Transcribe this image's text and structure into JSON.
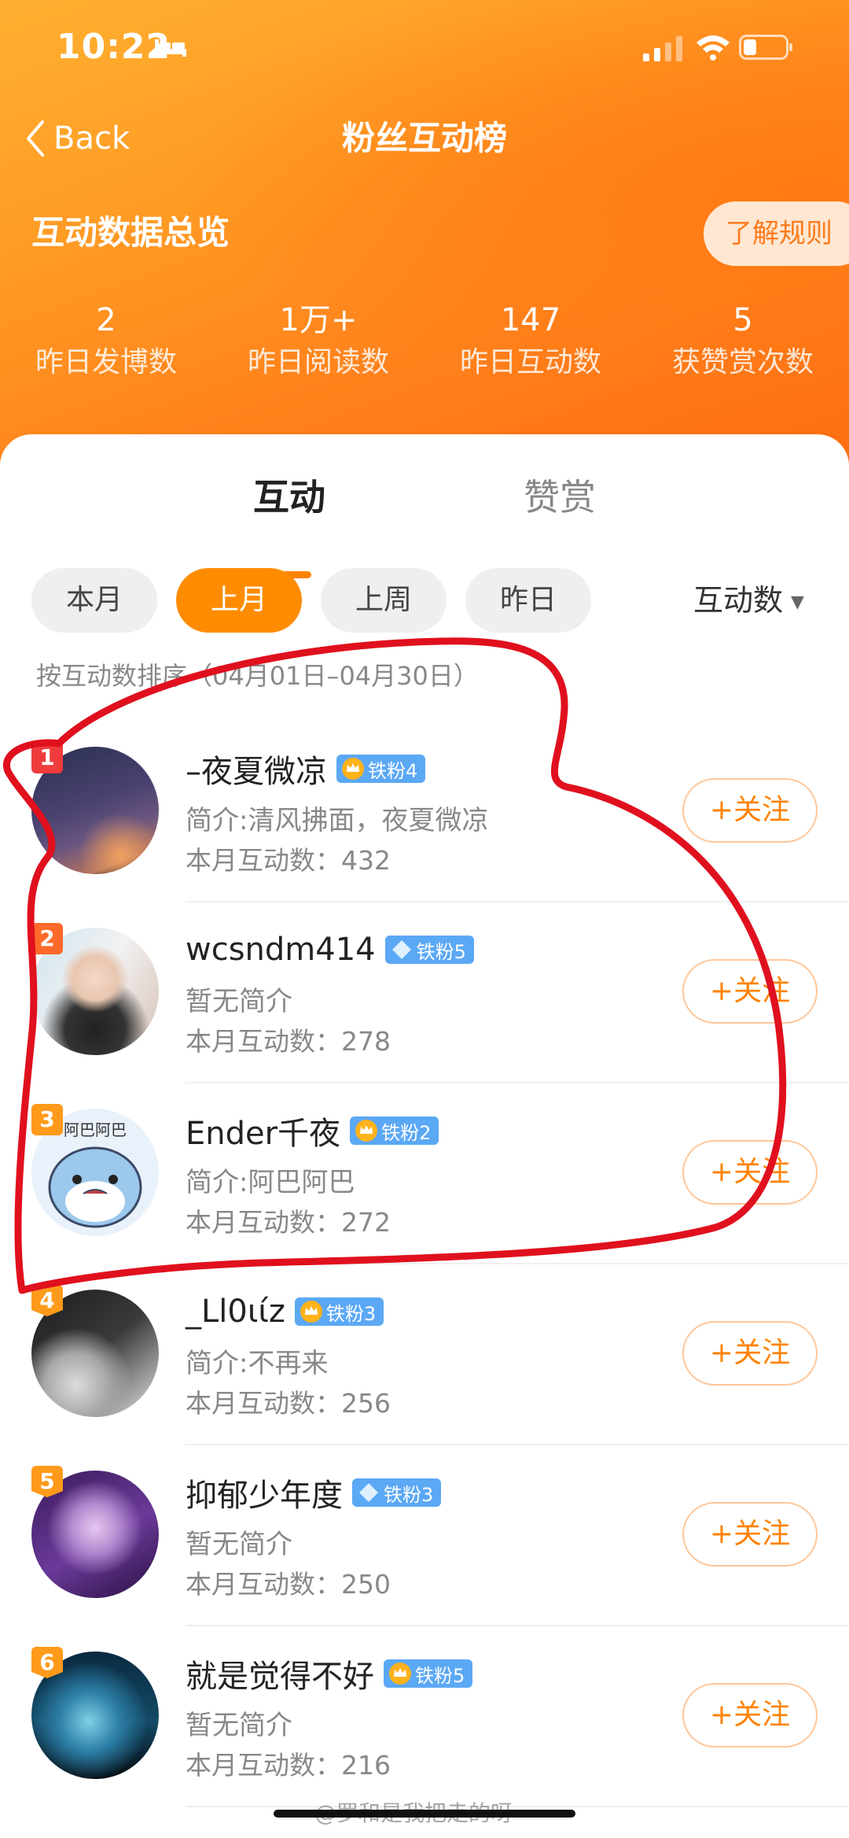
{
  "status_bar": {
    "time": "10:22"
  },
  "nav": {
    "back_label": "Back",
    "title": "粉丝互动榜"
  },
  "overview": {
    "title": "互动数据总览",
    "rules_label": "了解规则",
    "stats": [
      {
        "value": "2",
        "label": "昨日发博数"
      },
      {
        "value": "1万+",
        "label": "昨日阅读数"
      },
      {
        "value": "147",
        "label": "昨日互动数"
      },
      {
        "value": "5",
        "label": "获赞赏次数"
      }
    ]
  },
  "tabs": [
    {
      "label": "互动",
      "active": true
    },
    {
      "label": "赞赏",
      "active": false
    }
  ],
  "filters": [
    {
      "label": "本月",
      "active": false
    },
    {
      "label": "上月",
      "active": true
    },
    {
      "label": "上周",
      "active": false
    },
    {
      "label": "昨日",
      "active": false
    }
  ],
  "sort": {
    "label": "互动数",
    "description": "按互动数排序（04月01日–04月30日）"
  },
  "fans": [
    {
      "rank": "1",
      "name": "–夜夏微凉",
      "badge": "铁粉4",
      "badge_type": "crown",
      "bio": "简介:清风拂面，夜夏微凉",
      "count": "本月互动数：432",
      "follow": "+关注"
    },
    {
      "rank": "2",
      "name": "wcsndm414",
      "badge": "铁粉5",
      "badge_type": "diamond",
      "bio": "暂无简介",
      "count": "本月互动数：278",
      "follow": "+关注"
    },
    {
      "rank": "3",
      "name": "Ender千夜",
      "badge": "铁粉2",
      "badge_type": "crown",
      "bio": "简介:阿巴阿巴",
      "count": "本月互动数：272",
      "follow": "+关注"
    },
    {
      "rank": "4",
      "name": "_Ll0ιίz",
      "badge": "铁粉3",
      "badge_type": "crown",
      "bio": "简介:不再来",
      "count": "本月互动数：256",
      "follow": "+关注"
    },
    {
      "rank": "5",
      "name": "抑郁少年度",
      "badge": "铁粉3",
      "badge_type": "diamond",
      "bio": "暂无简介",
      "count": "本月互动数：250",
      "follow": "+关注"
    },
    {
      "rank": "6",
      "name": "就是觉得不好",
      "badge": "铁粉5",
      "badge_type": "crown",
      "bio": "暂无简介",
      "count": "本月互动数：216",
      "follow": "+关注"
    }
  ],
  "watermark": "@罗和是我把走的呀",
  "colors": {
    "accent": "#ff8200",
    "header_start": "#ffb030",
    "header_end": "#ff6c12",
    "badge_blue": "#5ba8f5",
    "annotation_red": "#e0101e"
  }
}
